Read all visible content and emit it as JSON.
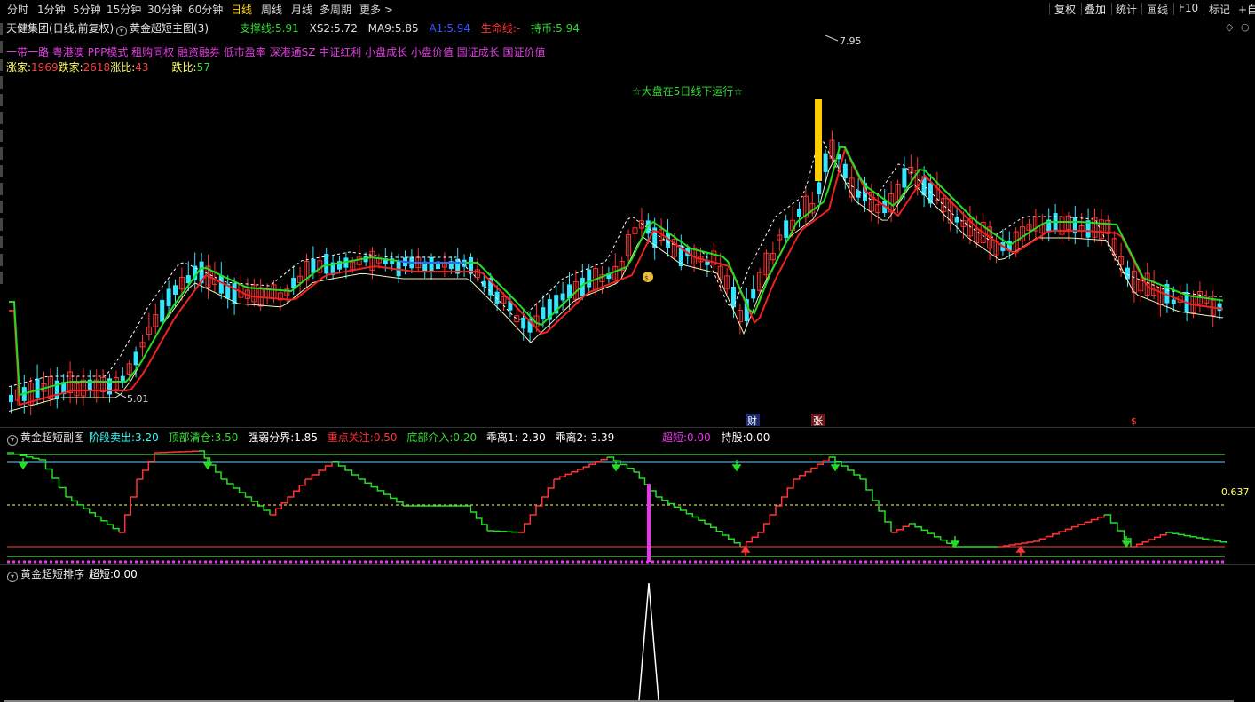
{
  "toolbar": {
    "periods": [
      "分时",
      "1分钟",
      "5分钟",
      "15分钟",
      "30分钟",
      "60分钟",
      "日线",
      "周线",
      "月线",
      "多周期",
      "更多 >"
    ],
    "active_period": "日线",
    "tools": [
      "复权",
      "叠加",
      "统计",
      "画线",
      "F10",
      "标记",
      "+自"
    ]
  },
  "main": {
    "stock": "天健集团(日线,前复权)",
    "indicator": "黄金超短主图(3)",
    "legend": [
      {
        "label": "支撑线:",
        "value": "5.91",
        "color": "#33dd33"
      },
      {
        "label": "XS2:",
        "value": "5.72",
        "color": "#e0e0e0"
      },
      {
        "label": "MA9:",
        "value": "5.85",
        "color": "#e0e0e0"
      },
      {
        "label": "A1:",
        "value": "5.94",
        "color": "#3355ff"
      },
      {
        "label": "生命线:",
        "value": "-",
        "color": "#ff3333"
      },
      {
        "label": "持币:",
        "value": "5.94",
        "color": "#33dd33"
      }
    ],
    "concepts": "一带一路 粤港澳 PPP模式 租购同权 融资融券 低市盈率 深港通SZ 中证红利 小盘成长 小盘价值 国证成长 国证价值",
    "breadth": {
      "up_label": "涨家:",
      "up_value": "1969",
      "down_label": "跌家:",
      "down_value": "2618",
      "up_ratio_label": "涨比:",
      "up_ratio": "43",
      "down_ratio_label": "跌比:",
      "down_ratio": "57"
    },
    "notice": "☆大盘在5日线下运行☆",
    "high_label": "7.95",
    "low_label": "5.01",
    "markers": {
      "cai": "财",
      "zhang": "张",
      "dollar": "$"
    },
    "colors": {
      "up": "#ff3333",
      "down": "#33e5ff",
      "ma_green": "#22dd22",
      "ma_red": "#ee2222",
      "ma_white": "#f0f0d0",
      "signal": "#ffcc00"
    }
  },
  "sub1": {
    "title": "黄金超短副图",
    "legend": [
      {
        "label": "阶段卖出:",
        "value": "3.20",
        "color": "#33ffff"
      },
      {
        "label": "顶部清仓:",
        "value": "3.50",
        "color": "#33dd33"
      },
      {
        "label": "强弱分界:",
        "value": "1.85",
        "color": "#ffffff"
      },
      {
        "label": "重点关注:",
        "value": "0.50",
        "color": "#ff3333"
      },
      {
        "label": "底部介入:",
        "value": "0.20",
        "color": "#33dd33"
      },
      {
        "label": "乖离1:",
        "value": "-2.30",
        "color": "#ffffff"
      },
      {
        "label": "乖离2:",
        "value": "-3.39",
        "color": "#ffffff"
      }
    ],
    "legend2": [
      {
        "label": "超短:",
        "value": "0.00",
        "color": "#ee33ee"
      },
      {
        "label": "持股:",
        "value": "0.00",
        "color": "#ffffff"
      }
    ],
    "axis_value": "0.637"
  },
  "sub2": {
    "title": "黄金超短排序",
    "legend": [
      {
        "label": "超短:",
        "value": "0.00",
        "color": "#ffffff"
      }
    ]
  }
}
